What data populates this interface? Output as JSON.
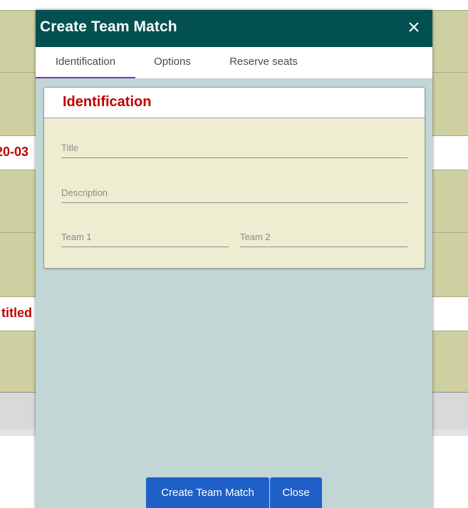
{
  "modal": {
    "title": "Create Team Match",
    "close_icon": "close-icon",
    "tabs": [
      {
        "label": "Identification",
        "active": true
      },
      {
        "label": "Options",
        "active": false
      },
      {
        "label": "Reserve seats",
        "active": false
      }
    ],
    "section_title": "Identification",
    "fields": {
      "title_placeholder": "Title",
      "description_placeholder": "Description",
      "team1_placeholder": "Team 1",
      "team2_placeholder": "Team 2"
    },
    "buttons": {
      "create": "Create Team Match",
      "close": "Close"
    }
  },
  "background": {
    "partial_text_1": "20-03",
    "partial_text_2": "titled"
  },
  "colors": {
    "header": "#025050",
    "modal_body": "#c2d6d5",
    "accent_red": "#c00000",
    "tab_underline": "#6d3bbd",
    "button_blue": "#1f60c8",
    "background_band": "#cfd0a1"
  }
}
